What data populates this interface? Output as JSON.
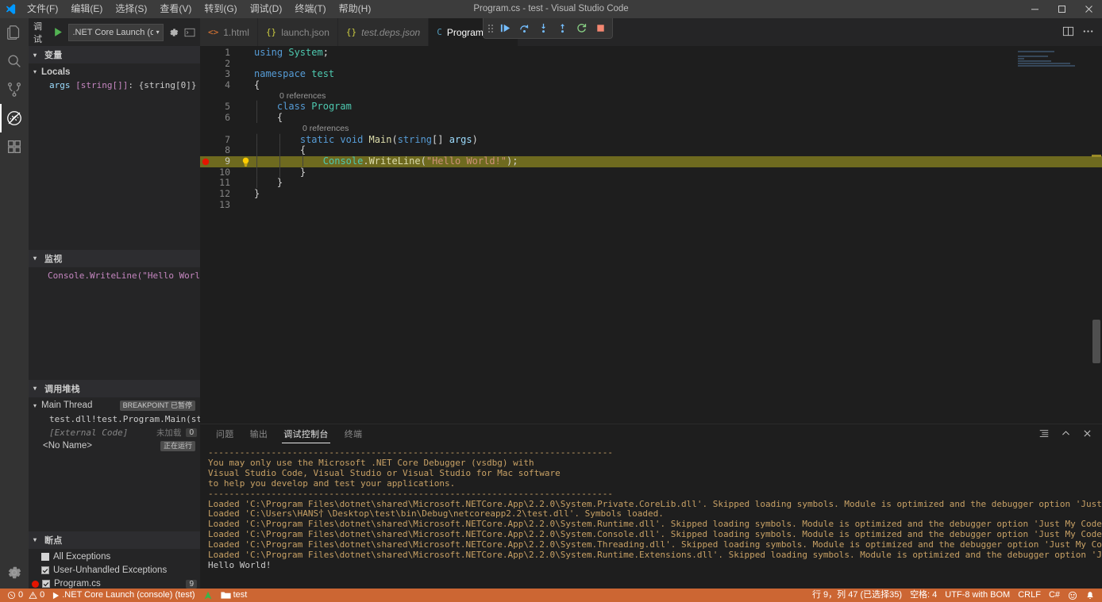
{
  "window": {
    "title": "Program.cs - test - Visual Studio Code",
    "minimize": "─",
    "maximize": "❐",
    "close": "✕"
  },
  "menu": {
    "items": [
      {
        "label": "文件(F)",
        "name": "menu-file"
      },
      {
        "label": "编辑(E)",
        "name": "menu-edit"
      },
      {
        "label": "选择(S)",
        "name": "menu-selection"
      },
      {
        "label": "查看(V)",
        "name": "menu-view"
      },
      {
        "label": "转到(G)",
        "name": "menu-go"
      },
      {
        "label": "调试(D)",
        "name": "menu-debug"
      },
      {
        "label": "终端(T)",
        "name": "menu-terminal"
      },
      {
        "label": "帮助(H)",
        "name": "menu-help"
      }
    ]
  },
  "activitybar": {
    "items": [
      {
        "name": "explorer-icon",
        "title": "资源管理器"
      },
      {
        "name": "search-icon",
        "title": "搜索"
      },
      {
        "name": "source-control-icon",
        "title": "源代码管理"
      },
      {
        "name": "run-debug-icon",
        "title": "运行和调试"
      },
      {
        "name": "extensions-icon",
        "title": "扩展"
      }
    ],
    "settings": "manage-gear-icon"
  },
  "debugbar": {
    "label": "调试",
    "start_icon": "start-debug-play-icon",
    "configuration": ".NET Core Launch (con",
    "caret": "▾",
    "gear_icon": "open-launch-json-gear-icon",
    "console_icon": "debug-console-icon"
  },
  "sidebar": {
    "variables": {
      "title": "变量",
      "scope": "Locals",
      "entries": [
        {
          "name": "args",
          "type": "[string[]]",
          "value": "{string[0]}"
        }
      ]
    },
    "watch": {
      "title": "监视",
      "entries": [
        {
          "expression": "Console.WriteLine(\"Hello World!\");: …"
        }
      ]
    },
    "callstack": {
      "title": "调用堆栈",
      "threads": [
        {
          "name": "Main Thread",
          "badge": "BREAKPOINT 已暂停",
          "frames": [
            {
              "label": "test.dll!test.Program.Main(string[] a",
              "note": ""
            },
            {
              "label": "[External Code]",
              "note": "未加载",
              "count": "0"
            }
          ]
        },
        {
          "name": "<No Name>",
          "badge": "正在运行",
          "frames": []
        }
      ]
    },
    "breakpoints": {
      "title": "断点",
      "entries": [
        {
          "label": "All Exceptions",
          "checked": false,
          "dot": false,
          "line": ""
        },
        {
          "label": "User-Unhandled Exceptions",
          "checked": true,
          "dot": false,
          "line": ""
        },
        {
          "label": "Program.cs",
          "checked": true,
          "dot": true,
          "line": "9"
        }
      ]
    }
  },
  "tabs": [
    {
      "name": "tab-1-html",
      "icon": "<>",
      "label": "1.html",
      "icon_color": "#e37933",
      "active": false,
      "italic": false
    },
    {
      "name": "tab-launch-json",
      "icon": "{}",
      "label": "launch.json",
      "icon_color": "#cbcb41",
      "active": false,
      "italic": false
    },
    {
      "name": "tab-test-deps-json",
      "icon": "{}",
      "label": "test.deps.json",
      "icon_color": "#cbcb41",
      "active": false,
      "italic": true
    },
    {
      "name": "tab-program-cs",
      "icon": "C",
      "label": "Program.cs",
      "icon_color": "#519aba",
      "active": true,
      "italic": false,
      "close": "✕"
    }
  ],
  "debug_toolbar": {
    "buttons": [
      {
        "name": "drag-handle-icon",
        "glyph": "grip"
      },
      {
        "name": "continue-icon",
        "glyph": "continue"
      },
      {
        "name": "step-over-icon",
        "glyph": "step-over"
      },
      {
        "name": "step-into-icon",
        "glyph": "step-into"
      },
      {
        "name": "step-out-icon",
        "glyph": "step-out"
      },
      {
        "name": "restart-icon",
        "glyph": "restart"
      },
      {
        "name": "stop-icon",
        "glyph": "stop"
      }
    ]
  },
  "editor": {
    "actions": [
      {
        "name": "split-editor-icon"
      },
      {
        "name": "more-actions-icon"
      }
    ],
    "lines": [
      {
        "num": "1",
        "kind": "code",
        "tokens": [
          {
            "t": "using ",
            "c": "k-blue"
          },
          {
            "t": "System",
            "c": "k-green"
          },
          {
            "t": ";",
            "c": "k-plain"
          }
        ],
        "indentGuides": 0
      },
      {
        "num": "2",
        "kind": "code",
        "tokens": [],
        "indentGuides": 0
      },
      {
        "num": "3",
        "kind": "code",
        "tokens": [
          {
            "t": "namespace ",
            "c": "k-blue"
          },
          {
            "t": "test",
            "c": "k-green"
          }
        ],
        "indentGuides": 0
      },
      {
        "num": "4",
        "kind": "code",
        "tokens": [
          {
            "t": "{",
            "c": "k-plain"
          }
        ],
        "indentGuides": 0
      },
      {
        "num": "",
        "kind": "codelens",
        "text": "0 references",
        "indent": 4
      },
      {
        "num": "5",
        "kind": "code",
        "tokens": [
          {
            "t": "    ",
            "c": "k-plain"
          },
          {
            "t": "class ",
            "c": "k-blue"
          },
          {
            "t": "Program",
            "c": "k-green"
          }
        ],
        "indentGuides": 1
      },
      {
        "num": "6",
        "kind": "code",
        "tokens": [
          {
            "t": "    {",
            "c": "k-plain"
          }
        ],
        "indentGuides": 1
      },
      {
        "num": "",
        "kind": "codelens",
        "text": "0 references",
        "indent": 8
      },
      {
        "num": "7",
        "kind": "code",
        "tokens": [
          {
            "t": "        ",
            "c": "k-plain"
          },
          {
            "t": "static ",
            "c": "k-blue"
          },
          {
            "t": "void ",
            "c": "k-blue"
          },
          {
            "t": "Main",
            "c": "k-func"
          },
          {
            "t": "(",
            "c": "k-plain"
          },
          {
            "t": "string",
            "c": "k-blue"
          },
          {
            "t": "[] ",
            "c": "k-plain"
          },
          {
            "t": "args",
            "c": "k-light"
          },
          {
            "t": ")",
            "c": "k-plain"
          }
        ],
        "indentGuides": 2
      },
      {
        "num": "8",
        "kind": "code",
        "tokens": [
          {
            "t": "        {",
            "c": "k-plain"
          }
        ],
        "indentGuides": 2
      },
      {
        "num": "9",
        "kind": "code",
        "current": true,
        "breakpoint": true,
        "lamp": true,
        "tokens": [
          {
            "t": "            ",
            "c": "k-plain"
          },
          {
            "t": "Console",
            "c": "k-green"
          },
          {
            "t": ".",
            "c": "k-plain"
          },
          {
            "t": "WriteLine",
            "c": "k-func"
          },
          {
            "t": "(",
            "c": "k-plain"
          },
          {
            "t": "\"Hello World!\"",
            "c": "k-str"
          },
          {
            "t": ");",
            "c": "k-plain"
          }
        ],
        "indentGuides": 3
      },
      {
        "num": "10",
        "kind": "code",
        "tokens": [
          {
            "t": "        }",
            "c": "k-plain"
          }
        ],
        "indentGuides": 2
      },
      {
        "num": "11",
        "kind": "code",
        "tokens": [
          {
            "t": "    }",
            "c": "k-plain"
          }
        ],
        "indentGuides": 1
      },
      {
        "num": "12",
        "kind": "code",
        "tokens": [
          {
            "t": "}",
            "c": "k-plain"
          }
        ],
        "indentGuides": 0
      },
      {
        "num": "13",
        "kind": "code",
        "tokens": [],
        "indentGuides": 0
      }
    ]
  },
  "panel": {
    "tabs": [
      {
        "name": "panel-tab-problems",
        "label": "问题",
        "active": false
      },
      {
        "name": "panel-tab-output",
        "label": "输出",
        "active": false
      },
      {
        "name": "panel-tab-debug-console",
        "label": "调试控制台",
        "active": true
      },
      {
        "name": "panel-tab-terminal",
        "label": "终端",
        "active": false
      }
    ],
    "actions": [
      {
        "name": "clear-console-icon"
      },
      {
        "name": "maximize-panel-icon"
      },
      {
        "name": "close-panel-icon"
      }
    ],
    "console_lines": [
      "-----------------------------------------------------------------------------",
      "You may only use the Microsoft .NET Core Debugger (vsdbg) with",
      "Visual Studio Code, Visual Studio or Visual Studio for Mac software",
      "to help you develop and test your applications.",
      "-----------------------------------------------------------------------------",
      "Loaded 'C:\\Program Files\\dotnet\\shared\\Microsoft.NETCore.App\\2.2.0\\System.Private.CoreLib.dll'. Skipped loading symbols. Module is optimized and the debugger option 'Just My Code' is enabled.",
      "Loaded 'C:\\Users\\HANS忄\\Desktop\\test\\bin\\Debug\\netcoreapp2.2\\test.dll'. Symbols loaded.",
      "Loaded 'C:\\Program Files\\dotnet\\shared\\Microsoft.NETCore.App\\2.2.0\\System.Runtime.dll'. Skipped loading symbols. Module is optimized and the debugger option 'Just My Code' is enabled.",
      "Loaded 'C:\\Program Files\\dotnet\\shared\\Microsoft.NETCore.App\\2.2.0\\System.Console.dll'. Skipped loading symbols. Module is optimized and the debugger option 'Just My Code' is enabled.",
      "Loaded 'C:\\Program Files\\dotnet\\shared\\Microsoft.NETCore.App\\2.2.0\\System.Threading.dll'. Skipped loading symbols. Module is optimized and the debugger option 'Just My Code' is enabled.",
      "Loaded 'C:\\Program Files\\dotnet\\shared\\Microsoft.NETCore.App\\2.2.0\\System.Runtime.Extensions.dll'. Skipped loading symbols. Module is optimized and the debugger option 'Just My Code' is enabled."
    ],
    "console_output": "Hello World!"
  },
  "statusbar": {
    "errors": "0",
    "warnings": "0",
    "launch": ".NET Core Launch (console) (test)",
    "folder": "test",
    "position": "行 9，列 47 (已选择35)",
    "spaces": "空格: 4",
    "encoding": "UTF-8 with BOM",
    "eol": "CRLF",
    "language": "C#",
    "feedback": "☺",
    "bell": "🔔"
  },
  "colors": {
    "accent_statusbar": "#cc6633",
    "breakpoint": "#e51400",
    "current_line": "#6e6a1f",
    "activity_bg": "#333333",
    "sidebar_bg": "#252526",
    "editor_bg": "#1e1e1e"
  }
}
